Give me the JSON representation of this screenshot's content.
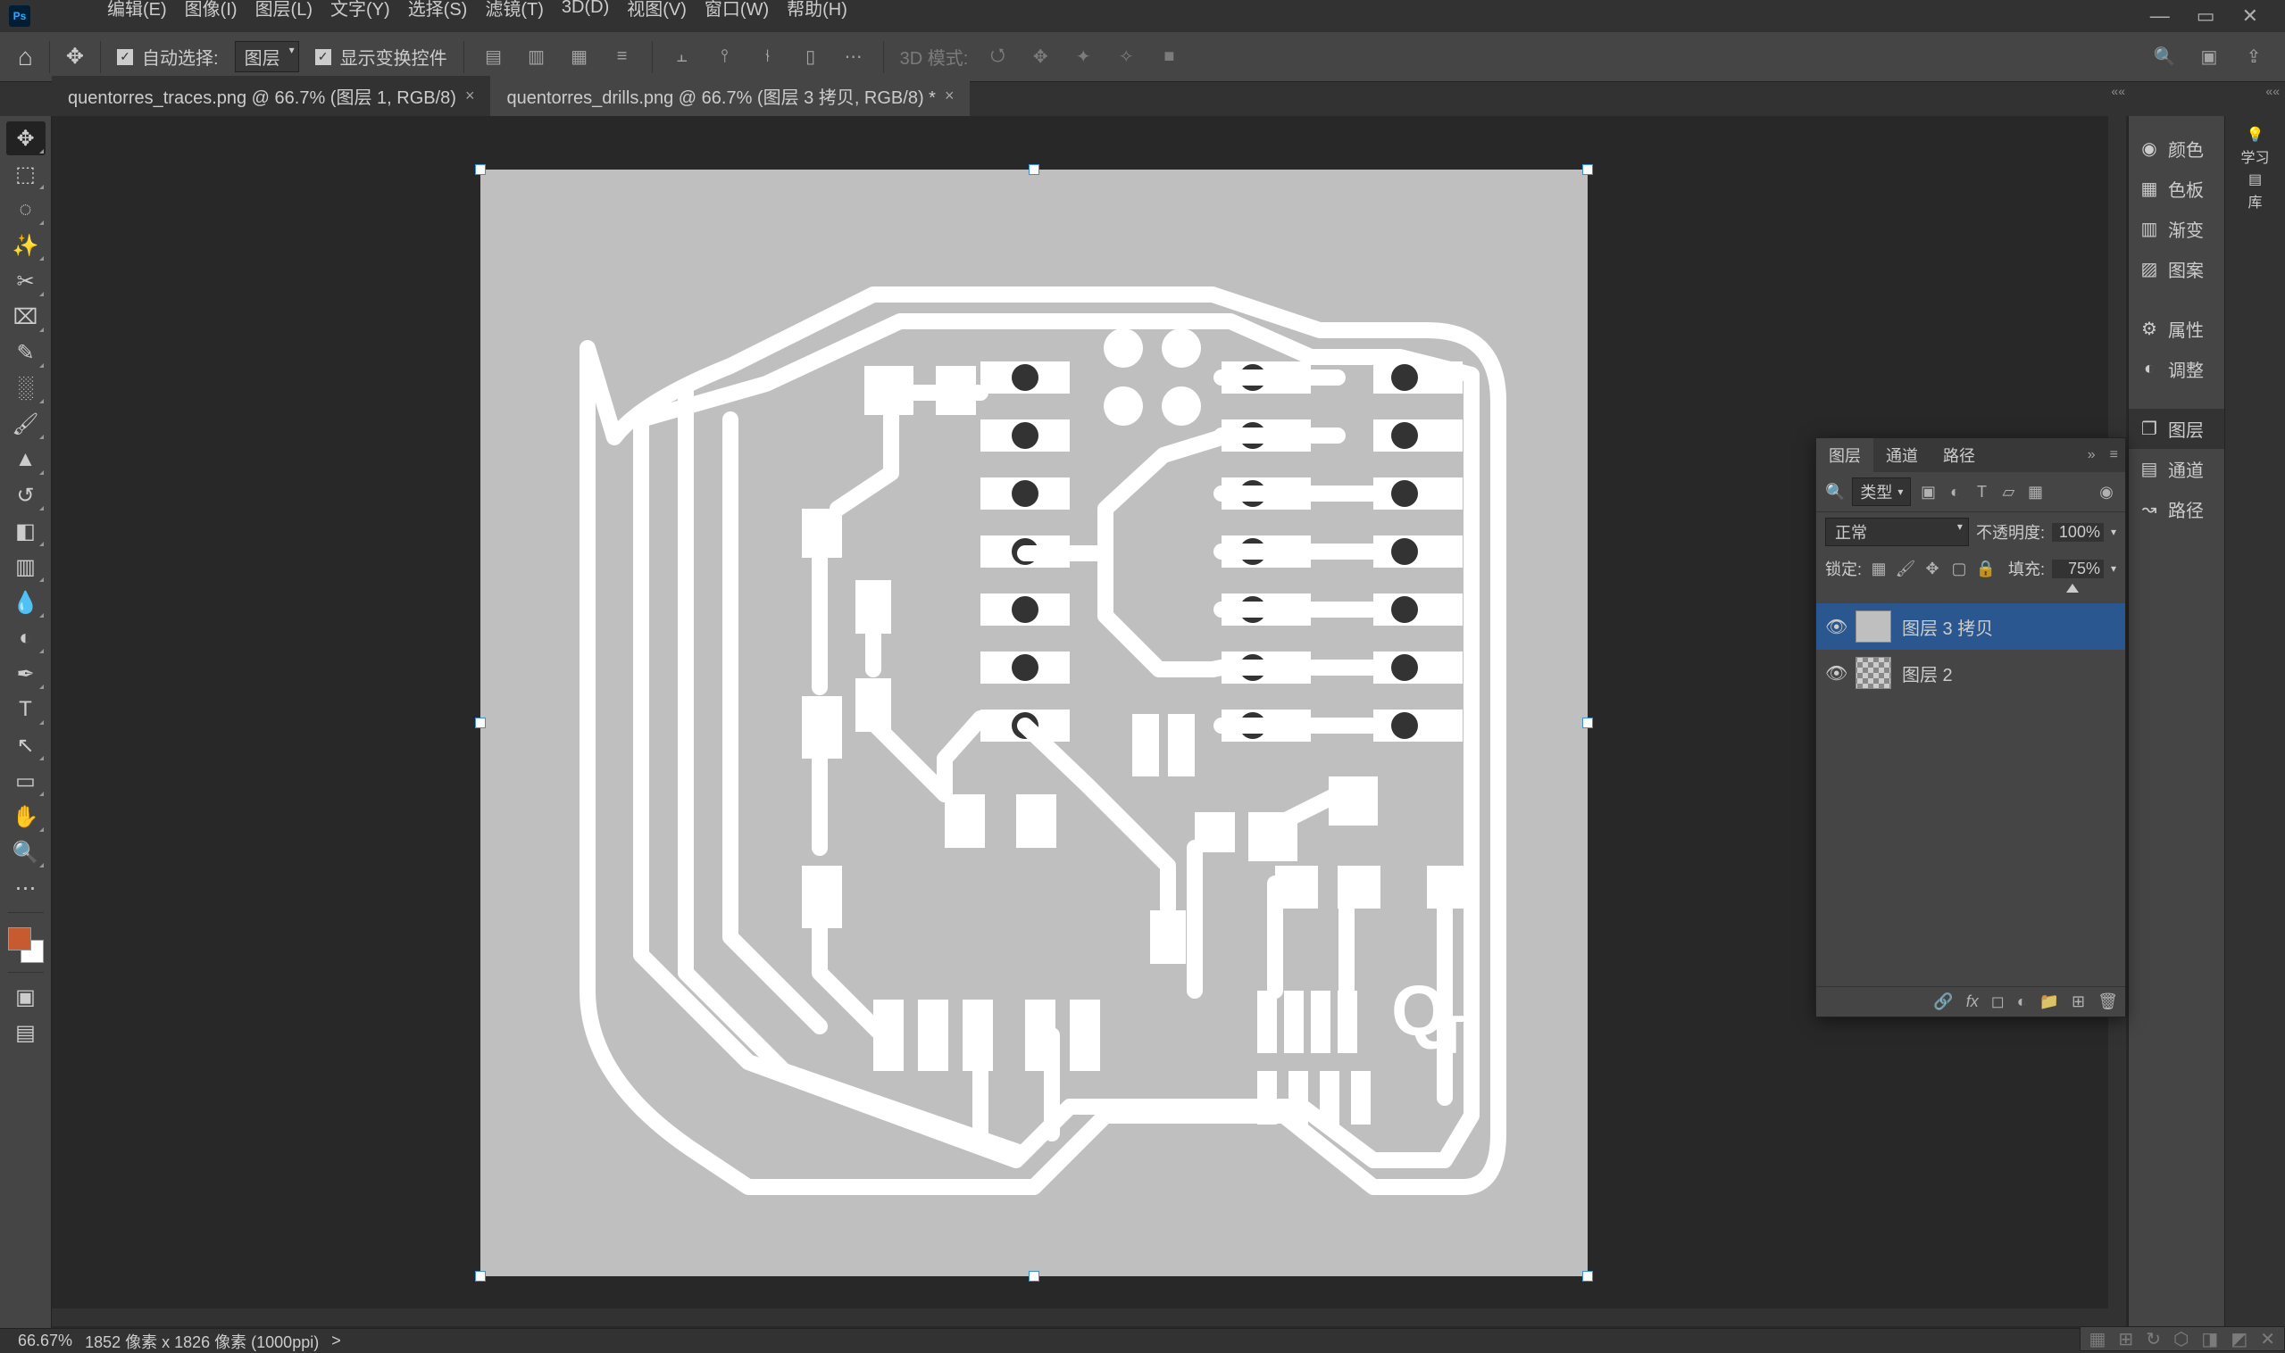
{
  "menu": {
    "edit": "编辑(E)",
    "image": "图像(I)",
    "layer": "图层(L)",
    "type": "文字(Y)",
    "select": "选择(S)",
    "filter": "滤镜(T)",
    "three_d": "3D(D)",
    "view": "视图(V)",
    "window": "窗口(W)",
    "help": "帮助(H)"
  },
  "options": {
    "auto_select": "自动选择:",
    "target": "图层",
    "show_transform": "显示变换控件",
    "mode3d_label": "3D 模式:"
  },
  "tabs": {
    "t1": "quentorres_traces.png @ 66.7% (图层 1, RGB/8)",
    "t2": "quentorres_drills.png @ 66.7% (图层 3 拷贝, RGB/8) *"
  },
  "status": {
    "zoom": "66.67%",
    "dims": "1852 像素 x 1826 像素 (1000ppi)",
    "arrow": ">"
  },
  "dock": {
    "color": "颜色",
    "swatches": "色板",
    "gradient": "渐变",
    "pattern": "图案",
    "properties": "属性",
    "adjust": "调整",
    "layers": "图层",
    "channels": "通道",
    "paths": "路径",
    "learn": "学习",
    "library": "库"
  },
  "layers_panel": {
    "tab_layers": "图层",
    "tab_channels": "通道",
    "tab_paths": "路径",
    "filter_kind": "类型",
    "blend_mode": "正常",
    "opacity_label": "不透明度:",
    "opacity_value": "100%",
    "lock_label": "锁定:",
    "fill_label": "填充:",
    "fill_value": "75%",
    "layer1_name": "图层 3 拷贝",
    "layer2_name": "图层 2"
  },
  "chart_data": null
}
